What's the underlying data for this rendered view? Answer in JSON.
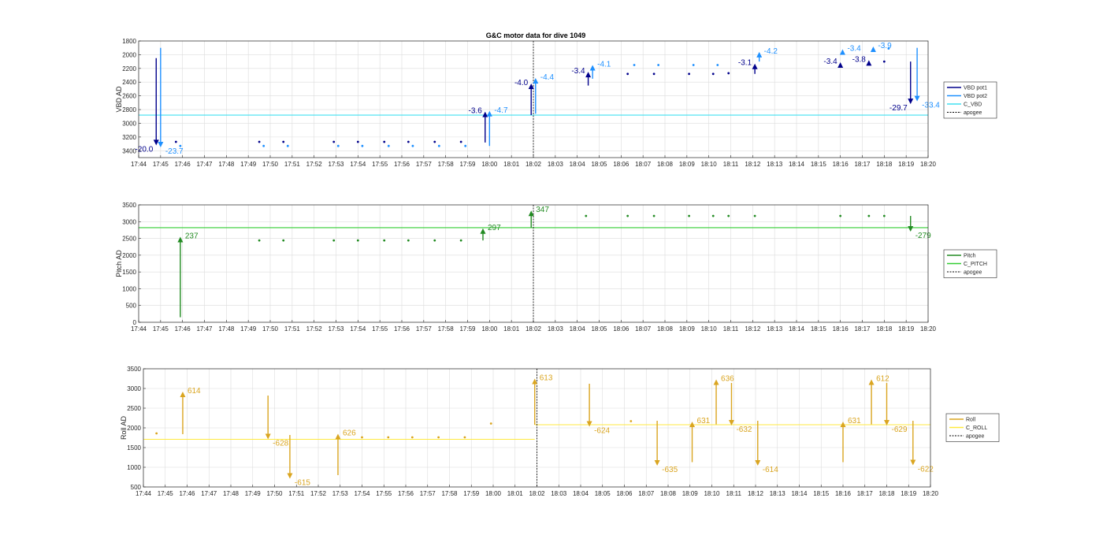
{
  "title": "G&C motor data for dive 1049",
  "colors": {
    "vbd_pot1": "#00008b",
    "vbd_pot2": "#1e90ff",
    "c_vbd": "#40e0f0",
    "pitch": "#228b22",
    "c_pitch": "#32cd32",
    "roll": "#daa520",
    "c_roll": "#ffea40",
    "apogee": "#000000"
  },
  "chart_data": [
    {
      "type": "scatter",
      "name": "vbd",
      "ylabel": "VBD AD",
      "ylim": [
        1800,
        3500
      ],
      "reversed": true,
      "yticks": [
        1800,
        2000,
        2200,
        2400,
        2600,
        2800,
        3000,
        3200,
        3400
      ],
      "xlim": [
        "17:44",
        "18:20"
      ],
      "xticks": [
        "17:44",
        "17:45",
        "17:46",
        "17:47",
        "17:48",
        "17:49",
        "17:50",
        "17:51",
        "17:52",
        "17:53",
        "17:54",
        "17:55",
        "17:56",
        "17:57",
        "17:58",
        "17:59",
        "18:00",
        "18:01",
        "18:02",
        "18:03",
        "18:04",
        "18:05",
        "18:06",
        "18:07",
        "18:08",
        "18:09",
        "18:10",
        "18:11",
        "18:12",
        "18:13",
        "18:14",
        "18:15",
        "18:16",
        "18:17",
        "18:18",
        "18:19",
        "18:20"
      ],
      "grid": true,
      "legend": {
        "placement": "outside-right",
        "entries": [
          "VBD pot1",
          "VBD pot2",
          "C_VBD",
          "apogee"
        ]
      },
      "reference_lines": [
        {
          "series": "C_VBD",
          "y": 2880,
          "color_key": "c_vbd"
        }
      ],
      "apogee_x": "18:02",
      "points": [
        {
          "series": "VBD pot1",
          "x": "17:45.7",
          "y": 3270
        },
        {
          "series": "VBD pot1",
          "x": "17:49.5",
          "y": 3270
        },
        {
          "series": "VBD pot1",
          "x": "17:50.6",
          "y": 3270
        },
        {
          "series": "VBD pot1",
          "x": "17:52.9",
          "y": 3270
        },
        {
          "series": "VBD pot1",
          "x": "17:54.0",
          "y": 3270
        },
        {
          "series": "VBD pot1",
          "x": "17:55.2",
          "y": 3270
        },
        {
          "series": "VBD pot1",
          "x": "17:56.3",
          "y": 3270
        },
        {
          "series": "VBD pot1",
          "x": "17:57.5",
          "y": 3270
        },
        {
          "series": "VBD pot1",
          "x": "17:58.7",
          "y": 3270
        },
        {
          "series": "VBD pot1",
          "x": "18:06.3",
          "y": 2280
        },
        {
          "series": "VBD pot1",
          "x": "18:07.5",
          "y": 2280
        },
        {
          "series": "VBD pot1",
          "x": "18:09.1",
          "y": 2280
        },
        {
          "series": "VBD pot1",
          "x": "18:10.2",
          "y": 2280
        },
        {
          "series": "VBD pot1",
          "x": "18:10.9",
          "y": 2270
        },
        {
          "series": "VBD pot1",
          "x": "18:18.0",
          "y": 2100
        },
        {
          "series": "VBD pot2",
          "x": "17:45.9",
          "y": 3330
        },
        {
          "series": "VBD pot2",
          "x": "17:49.7",
          "y": 3330
        },
        {
          "series": "VBD pot2",
          "x": "17:50.8",
          "y": 3330
        },
        {
          "series": "VBD pot2",
          "x": "17:53.1",
          "y": 3330
        },
        {
          "series": "VBD pot2",
          "x": "17:54.2",
          "y": 3330
        },
        {
          "series": "VBD pot2",
          "x": "17:55.4",
          "y": 3330
        },
        {
          "series": "VBD pot2",
          "x": "17:56.5",
          "y": 3330
        },
        {
          "series": "VBD pot2",
          "x": "17:57.7",
          "y": 3330
        },
        {
          "series": "VBD pot2",
          "x": "17:58.9",
          "y": 3330
        },
        {
          "series": "VBD pot2",
          "x": "18:06.6",
          "y": 2150
        },
        {
          "series": "VBD pot2",
          "x": "18:07.7",
          "y": 2150
        },
        {
          "series": "VBD pot2",
          "x": "18:09.3",
          "y": 2150
        },
        {
          "series": "VBD pot2",
          "x": "18:10.4",
          "y": 2150
        },
        {
          "series": "VBD pot2",
          "x": "18:18.2",
          "y": 1910
        }
      ],
      "arrows": [
        {
          "series": "VBD pot1",
          "x": "17:44.8",
          "y0": 2050,
          "y1": 3320,
          "label": "-20.0",
          "label_side": "left"
        },
        {
          "series": "VBD pot2",
          "x": "17:45.0",
          "y0": 1900,
          "y1": 3350,
          "label": "-23.7",
          "label_side": "right"
        },
        {
          "series": "VBD pot1",
          "x": "17:59.8",
          "y0": 3280,
          "y1": 2830,
          "label": "-3.6",
          "label_side": "left"
        },
        {
          "series": "VBD pot2",
          "x": "18:00.0",
          "y0": 3330,
          "y1": 2820,
          "label": "-4.7",
          "label_side": "right"
        },
        {
          "series": "VBD pot1",
          "x": "18:01.9",
          "y0": 2880,
          "y1": 2420,
          "label": "-4.0",
          "label_side": "left"
        },
        {
          "series": "VBD pot2",
          "x": "18:02.1",
          "y0": 2860,
          "y1": 2340,
          "label": "-4.4",
          "label_side": "right"
        },
        {
          "series": "VBD pot1",
          "x": "18:04.5",
          "y0": 2450,
          "y1": 2250,
          "label": "-3.4",
          "label_side": "left"
        },
        {
          "series": "VBD pot2",
          "x": "18:04.7",
          "y0": 2350,
          "y1": 2150,
          "label": "-4.1",
          "label_side": "right"
        },
        {
          "series": "VBD pot1",
          "x": "18:12.1",
          "y0": 2280,
          "y1": 2130,
          "label": "-3.1",
          "label_side": "left"
        },
        {
          "series": "VBD pot2",
          "x": "18:12.3",
          "y0": 2100,
          "y1": 1960,
          "label": "-4.2",
          "label_side": "right"
        },
        {
          "series": "VBD pot1",
          "x": "18:16.0",
          "y0": 2150,
          "y1": 2110,
          "label": "-3.4",
          "label_side": "left"
        },
        {
          "series": "VBD pot2",
          "x": "18:16.1",
          "y0": 1960,
          "y1": 1920,
          "label": "-3.4",
          "label_side": "right"
        },
        {
          "series": "VBD pot1",
          "x": "18:17.3",
          "y0": 2120,
          "y1": 2080,
          "label": "-3.8",
          "label_side": "left"
        },
        {
          "series": "VBD pot2",
          "x": "18:17.5",
          "y0": 1920,
          "y1": 1880,
          "label": "-3.9",
          "label_side": "right"
        },
        {
          "series": "VBD pot1",
          "x": "18:19.2",
          "y0": 2100,
          "y1": 2720,
          "label": "-29.7",
          "label_side": "left"
        },
        {
          "series": "VBD pot2",
          "x": "18:19.5",
          "y0": 1900,
          "y1": 2680,
          "label": "-33.4",
          "label_side": "right"
        }
      ]
    },
    {
      "type": "scatter",
      "name": "pitch",
      "ylabel": "Pitch AD",
      "ylim": [
        0,
        3500
      ],
      "reversed": false,
      "yticks": [
        0,
        500,
        1000,
        1500,
        2000,
        2500,
        3000,
        3500
      ],
      "xlim": [
        "17:44",
        "18:20"
      ],
      "xticks": [
        "17:44",
        "17:45",
        "17:46",
        "17:47",
        "17:48",
        "17:49",
        "17:50",
        "17:51",
        "17:52",
        "17:53",
        "17:54",
        "17:55",
        "17:56",
        "17:57",
        "17:58",
        "17:59",
        "18:00",
        "18:01",
        "18:02",
        "18:03",
        "18:04",
        "18:05",
        "18:06",
        "18:07",
        "18:08",
        "18:09",
        "18:10",
        "18:11",
        "18:12",
        "18:13",
        "18:14",
        "18:15",
        "18:16",
        "18:17",
        "18:18",
        "18:19",
        "18:20"
      ],
      "grid": true,
      "legend": {
        "placement": "outside-right",
        "entries": [
          "Pitch",
          "C_PITCH",
          "apogee"
        ]
      },
      "reference_lines": [
        {
          "series": "C_PITCH",
          "y": 2820,
          "color_key": "c_pitch"
        }
      ],
      "apogee_x": "18:02",
      "points": [
        {
          "series": "Pitch",
          "x": "17:49.5",
          "y": 2440
        },
        {
          "series": "Pitch",
          "x": "17:50.6",
          "y": 2440
        },
        {
          "series": "Pitch",
          "x": "17:52.9",
          "y": 2440
        },
        {
          "series": "Pitch",
          "x": "17:54.0",
          "y": 2440
        },
        {
          "series": "Pitch",
          "x": "17:55.2",
          "y": 2440
        },
        {
          "series": "Pitch",
          "x": "17:56.3",
          "y": 2440
        },
        {
          "series": "Pitch",
          "x": "17:57.5",
          "y": 2440
        },
        {
          "series": "Pitch",
          "x": "17:58.7",
          "y": 2440
        },
        {
          "series": "Pitch",
          "x": "18:04.4",
          "y": 3170
        },
        {
          "series": "Pitch",
          "x": "18:06.3",
          "y": 3170
        },
        {
          "series": "Pitch",
          "x": "18:07.5",
          "y": 3170
        },
        {
          "series": "Pitch",
          "x": "18:09.1",
          "y": 3170
        },
        {
          "series": "Pitch",
          "x": "18:10.2",
          "y": 3170
        },
        {
          "series": "Pitch",
          "x": "18:10.9",
          "y": 3170
        },
        {
          "series": "Pitch",
          "x": "18:12.1",
          "y": 3170
        },
        {
          "series": "Pitch",
          "x": "18:16.0",
          "y": 3170
        },
        {
          "series": "Pitch",
          "x": "18:17.3",
          "y": 3170
        },
        {
          "series": "Pitch",
          "x": "18:18.0",
          "y": 3170
        }
      ],
      "arrows": [
        {
          "series": "Pitch",
          "x": "17:45.9",
          "y0": 150,
          "y1": 2550,
          "label": "237",
          "label_side": "right"
        },
        {
          "series": "Pitch",
          "x": "17:59.7",
          "y0": 2440,
          "y1": 2800,
          "label": "297",
          "label_side": "right"
        },
        {
          "series": "Pitch",
          "x": "18:01.9",
          "y0": 2820,
          "y1": 3330,
          "label": "347",
          "label_side": "right"
        },
        {
          "series": "Pitch",
          "x": "18:19.2",
          "y0": 3170,
          "y1": 2700,
          "label": "-279",
          "label_side": "right"
        }
      ]
    },
    {
      "type": "scatter",
      "name": "roll",
      "ylabel": "Roll AD",
      "ylim": [
        500,
        3500
      ],
      "reversed": false,
      "yticks": [
        500,
        1000,
        1500,
        2000,
        2500,
        3000,
        3500
      ],
      "xlim": [
        "17:44",
        "18:20"
      ],
      "xticks": [
        "17:44",
        "17:45",
        "17:46",
        "17:47",
        "17:48",
        "17:49",
        "17:50",
        "17:51",
        "17:52",
        "17:53",
        "17:54",
        "17:55",
        "17:56",
        "17:57",
        "17:58",
        "17:59",
        "18:00",
        "18:01",
        "18:02",
        "18:03",
        "18:04",
        "18:05",
        "18:06",
        "18:07",
        "18:08",
        "18:09",
        "18:10",
        "18:11",
        "18:12",
        "18:13",
        "18:14",
        "18:15",
        "18:16",
        "18:17",
        "18:18",
        "18:19",
        "18:20"
      ],
      "grid": true,
      "legend": {
        "placement": "outside-right",
        "entries": [
          "Roll",
          "C_ROLL",
          "apogee"
        ]
      },
      "reference_lines": [
        {
          "series": "C_ROLL",
          "x0": "17:44",
          "x1": "18:01.9",
          "y": 1710,
          "color_key": "c_roll"
        },
        {
          "series": "C_ROLL",
          "x0": "18:01.9",
          "x1": "18:20",
          "y": 2080,
          "color_key": "c_roll"
        }
      ],
      "apogee_x": "18:02",
      "points": [
        {
          "series": "Roll",
          "x": "17:44.6",
          "y": 1860
        },
        {
          "series": "Roll",
          "x": "17:54.0",
          "y": 1760
        },
        {
          "series": "Roll",
          "x": "17:55.2",
          "y": 1760
        },
        {
          "series": "Roll",
          "x": "17:56.3",
          "y": 1760
        },
        {
          "series": "Roll",
          "x": "17:57.5",
          "y": 1760
        },
        {
          "series": "Roll",
          "x": "17:58.7",
          "y": 1760
        },
        {
          "series": "Roll",
          "x": "17:59.9",
          "y": 2110
        },
        {
          "series": "Roll",
          "x": "18:06.3",
          "y": 2170
        }
      ],
      "arrows": [
        {
          "series": "Roll",
          "x": "17:45.8",
          "y0": 1840,
          "y1": 2920,
          "label": "614",
          "label_side": "right"
        },
        {
          "series": "Roll",
          "x": "17:49.7",
          "y0": 2820,
          "y1": 1710,
          "label": "-628",
          "label_side": "right"
        },
        {
          "series": "Roll",
          "x": "17:50.7",
          "y0": 1820,
          "y1": 710,
          "label": "-615",
          "label_side": "right"
        },
        {
          "series": "Roll",
          "x": "17:52.9",
          "y0": 800,
          "y1": 1850,
          "label": "626",
          "label_side": "right"
        },
        {
          "series": "Roll",
          "x": "18:01.9",
          "y0": 2080,
          "y1": 3250,
          "label": "613",
          "label_side": "right"
        },
        {
          "series": "Roll",
          "x": "18:04.4",
          "y0": 3120,
          "y1": 2030,
          "label": "-624",
          "label_side": "right"
        },
        {
          "series": "Roll",
          "x": "18:07.5",
          "y0": 2180,
          "y1": 1040,
          "label": "-635",
          "label_side": "right"
        },
        {
          "series": "Roll",
          "x": "18:09.1",
          "y0": 1130,
          "y1": 2160,
          "label": "631",
          "label_side": "right"
        },
        {
          "series": "Roll",
          "x": "18:10.2",
          "y0": 2090,
          "y1": 3230,
          "label": "636",
          "label_side": "right"
        },
        {
          "series": "Roll",
          "x": "18:10.9",
          "y0": 3140,
          "y1": 2060,
          "label": "-632",
          "label_side": "right"
        },
        {
          "series": "Roll",
          "x": "18:12.1",
          "y0": 2180,
          "y1": 1040,
          "label": "-614",
          "label_side": "right"
        },
        {
          "series": "Roll",
          "x": "18:16.0",
          "y0": 1130,
          "y1": 2160,
          "label": "631",
          "label_side": "right"
        },
        {
          "series": "Roll",
          "x": "18:17.3",
          "y0": 2090,
          "y1": 3230,
          "label": "612",
          "label_side": "right"
        },
        {
          "series": "Roll",
          "x": "18:18.0",
          "y0": 3140,
          "y1": 2060,
          "label": "-629",
          "label_side": "right"
        },
        {
          "series": "Roll",
          "x": "18:19.2",
          "y0": 2180,
          "y1": 1050,
          "label": "-622",
          "label_side": "right"
        }
      ]
    }
  ]
}
